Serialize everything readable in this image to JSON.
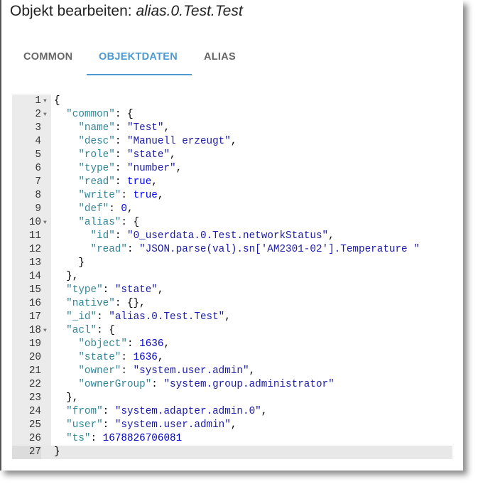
{
  "dialog": {
    "title_prefix": "Objekt bearbeiten: ",
    "title_object": "alias.0.Test.Test"
  },
  "tabs": [
    {
      "label": "COMMON",
      "active": false
    },
    {
      "label": "OBJEKTDATEN",
      "active": true
    },
    {
      "label": "ALIAS",
      "active": false
    }
  ],
  "colors": {
    "accent": "#4d9ad0",
    "key": "#318495",
    "string": "#1a1aa6",
    "number": "#0000cd"
  },
  "editor": {
    "active_line": 27,
    "foldable_lines": [
      1,
      2,
      10,
      18
    ],
    "lines": [
      [
        [
          "p",
          "{"
        ]
      ],
      [
        [
          "p",
          "  "
        ],
        [
          "k",
          "\"common\""
        ],
        [
          "p",
          ": {"
        ]
      ],
      [
        [
          "p",
          "    "
        ],
        [
          "k",
          "\"name\""
        ],
        [
          "p",
          ": "
        ],
        [
          "s",
          "\"Test\""
        ],
        [
          "p",
          ","
        ]
      ],
      [
        [
          "p",
          "    "
        ],
        [
          "k",
          "\"desc\""
        ],
        [
          "p",
          ": "
        ],
        [
          "s",
          "\"Manuell erzeugt\""
        ],
        [
          "p",
          ","
        ]
      ],
      [
        [
          "p",
          "    "
        ],
        [
          "k",
          "\"role\""
        ],
        [
          "p",
          ": "
        ],
        [
          "s",
          "\"state\""
        ],
        [
          "p",
          ","
        ]
      ],
      [
        [
          "p",
          "    "
        ],
        [
          "k",
          "\"type\""
        ],
        [
          "p",
          ": "
        ],
        [
          "s",
          "\"number\""
        ],
        [
          "p",
          ","
        ]
      ],
      [
        [
          "p",
          "    "
        ],
        [
          "k",
          "\"read\""
        ],
        [
          "p",
          ": "
        ],
        [
          "b",
          "true"
        ],
        [
          "p",
          ","
        ]
      ],
      [
        [
          "p",
          "    "
        ],
        [
          "k",
          "\"write\""
        ],
        [
          "p",
          ": "
        ],
        [
          "b",
          "true"
        ],
        [
          "p",
          ","
        ]
      ],
      [
        [
          "p",
          "    "
        ],
        [
          "k",
          "\"def\""
        ],
        [
          "p",
          ": "
        ],
        [
          "n",
          "0"
        ],
        [
          "p",
          ","
        ]
      ],
      [
        [
          "p",
          "    "
        ],
        [
          "k",
          "\"alias\""
        ],
        [
          "p",
          ": {"
        ]
      ],
      [
        [
          "p",
          "      "
        ],
        [
          "k",
          "\"id\""
        ],
        [
          "p",
          ": "
        ],
        [
          "s",
          "\"0_userdata.0.Test.networkStatus\""
        ],
        [
          "p",
          ","
        ]
      ],
      [
        [
          "p",
          "      "
        ],
        [
          "k",
          "\"read\""
        ],
        [
          "p",
          ": "
        ],
        [
          "s",
          "\"JSON.parse(val).sn['AM2301-02'].Temperature \""
        ]
      ],
      [
        [
          "p",
          "    }"
        ]
      ],
      [
        [
          "p",
          "  },"
        ]
      ],
      [
        [
          "p",
          "  "
        ],
        [
          "k",
          "\"type\""
        ],
        [
          "p",
          ": "
        ],
        [
          "s",
          "\"state\""
        ],
        [
          "p",
          ","
        ]
      ],
      [
        [
          "p",
          "  "
        ],
        [
          "k",
          "\"native\""
        ],
        [
          "p",
          ": {},"
        ]
      ],
      [
        [
          "p",
          "  "
        ],
        [
          "k",
          "\"_id\""
        ],
        [
          "p",
          ": "
        ],
        [
          "s",
          "\"alias.0.Test.Test\""
        ],
        [
          "p",
          ","
        ]
      ],
      [
        [
          "p",
          "  "
        ],
        [
          "k",
          "\"acl\""
        ],
        [
          "p",
          ": {"
        ]
      ],
      [
        [
          "p",
          "    "
        ],
        [
          "k",
          "\"object\""
        ],
        [
          "p",
          ": "
        ],
        [
          "n",
          "1636"
        ],
        [
          "p",
          ","
        ]
      ],
      [
        [
          "p",
          "    "
        ],
        [
          "k",
          "\"state\""
        ],
        [
          "p",
          ": "
        ],
        [
          "n",
          "1636"
        ],
        [
          "p",
          ","
        ]
      ],
      [
        [
          "p",
          "    "
        ],
        [
          "k",
          "\"owner\""
        ],
        [
          "p",
          ": "
        ],
        [
          "s",
          "\"system.user.admin\""
        ],
        [
          "p",
          ","
        ]
      ],
      [
        [
          "p",
          "    "
        ],
        [
          "k",
          "\"ownerGroup\""
        ],
        [
          "p",
          ": "
        ],
        [
          "s",
          "\"system.group.administrator\""
        ]
      ],
      [
        [
          "p",
          "  },"
        ]
      ],
      [
        [
          "p",
          "  "
        ],
        [
          "k",
          "\"from\""
        ],
        [
          "p",
          ": "
        ],
        [
          "s",
          "\"system.adapter.admin.0\""
        ],
        [
          "p",
          ","
        ]
      ],
      [
        [
          "p",
          "  "
        ],
        [
          "k",
          "\"user\""
        ],
        [
          "p",
          ": "
        ],
        [
          "s",
          "\"system.user.admin\""
        ],
        [
          "p",
          ","
        ]
      ],
      [
        [
          "p",
          "  "
        ],
        [
          "k",
          "\"ts\""
        ],
        [
          "p",
          ": "
        ],
        [
          "n",
          "1678826706081"
        ]
      ],
      [
        [
          "p",
          "}"
        ]
      ]
    ]
  }
}
